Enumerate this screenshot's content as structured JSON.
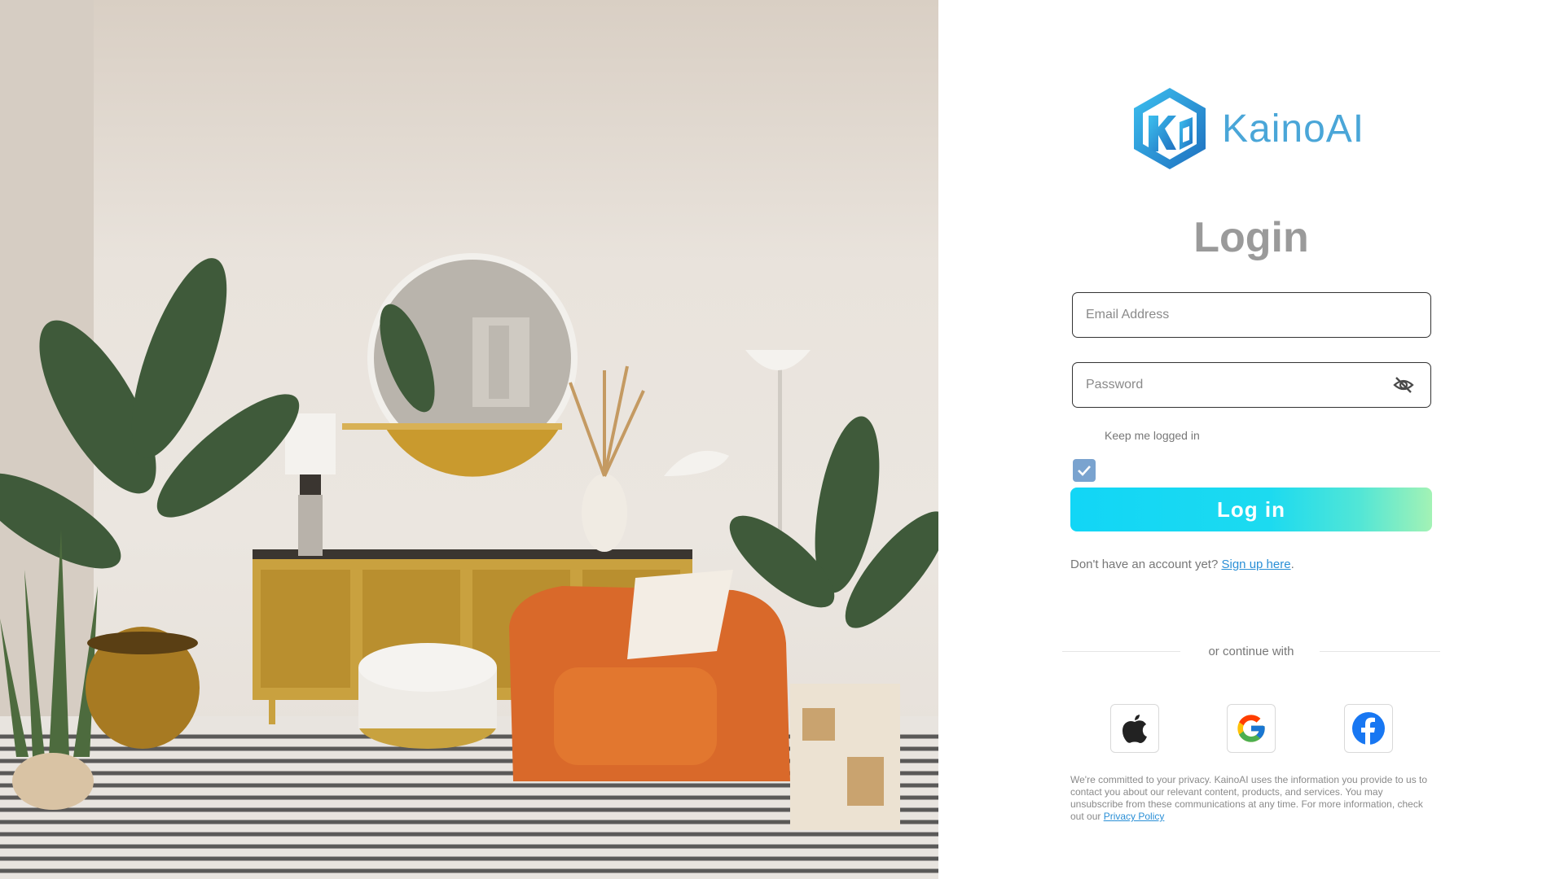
{
  "brand": {
    "name": "KainoAI",
    "logo_icon": "hexagon-k-logo-icon",
    "color": "#4aa6d8"
  },
  "login": {
    "title": "Login",
    "email_placeholder": "Email Address",
    "password_placeholder": "Password",
    "password_toggle_icon": "eye-slash-icon",
    "keep_logged_in_label": "Keep me logged in",
    "keep_logged_in_checked": true,
    "submit_label": "Log in",
    "signup_prompt": "Don't have an account yet?",
    "signup_link": "Sign up here",
    "signup_suffix": "."
  },
  "social": {
    "divider_text": "or continue with",
    "providers": [
      {
        "name": "Apple",
        "icon": "apple-icon"
      },
      {
        "name": "Google",
        "icon": "google-icon"
      },
      {
        "name": "Facebook",
        "icon": "facebook-icon"
      }
    ]
  },
  "privacy": {
    "text": "We're committed to your privacy. KainoAI uses the information you provide to us to contact you about our relevant content, products, and services. You may unsubscribe from these communications at any time. For more information, check out our",
    "link": "Privacy Policy"
  },
  "hero": {
    "description_icon": "living-room-photo",
    "accent_colors": {
      "chair": "#e0722a",
      "wall": "#e8e2dc",
      "gold": "#c49a33"
    }
  },
  "colors": {
    "button_gradient_start": "#12d6f6",
    "button_gradient_end": "#a3f2b5",
    "link": "#2a8fd6",
    "checkbox": "#7aa3cf"
  }
}
